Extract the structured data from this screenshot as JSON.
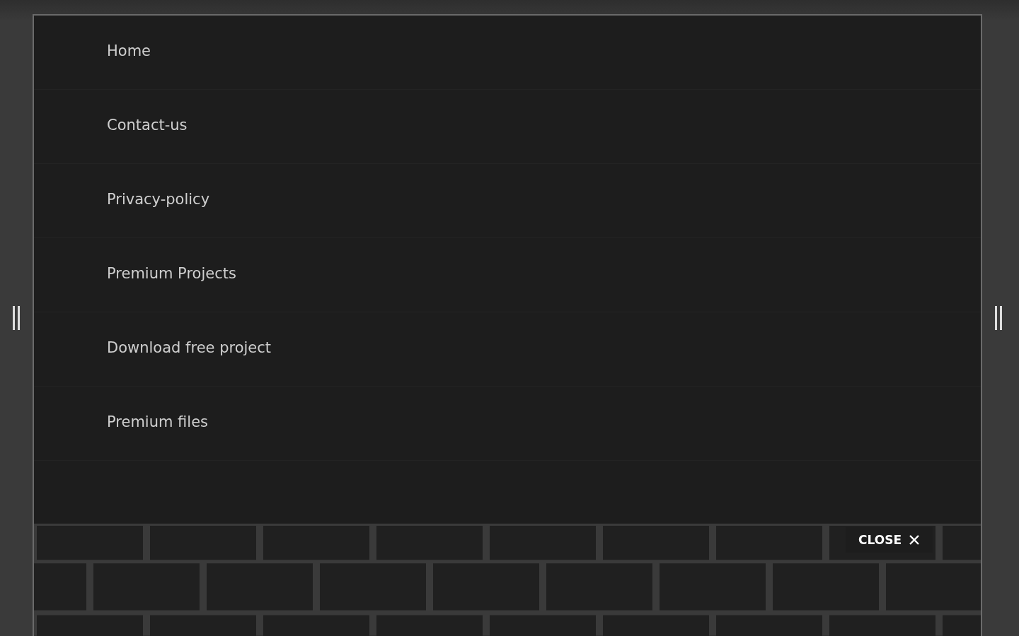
{
  "menu": {
    "items": [
      {
        "label": "Home"
      },
      {
        "label": "Contact-us"
      },
      {
        "label": "Privacy-policy"
      },
      {
        "label": "Premium Projects"
      },
      {
        "label": "Download free project"
      },
      {
        "label": "Premium files"
      }
    ]
  },
  "header": {
    "kind": "picture",
    "close_label": "CLOSE"
  }
}
